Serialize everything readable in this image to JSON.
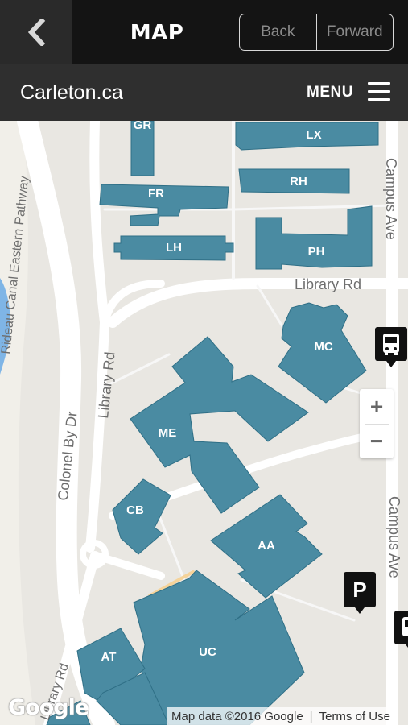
{
  "header": {
    "title": "MAP",
    "back_label": "Back",
    "forward_label": "Forward"
  },
  "subheader": {
    "site_name": "Carleton.ca",
    "menu_label": "MENU"
  },
  "map": {
    "buildings": [
      "GR",
      "LX",
      "FR",
      "RH",
      "LH",
      "PH",
      "MC",
      "ME",
      "CB",
      "AA",
      "AT",
      "UC"
    ],
    "roads": {
      "library_rd_top": "Library Rd",
      "library_rd_side": "Library Rd",
      "campus_ave_top": "Campus Ave",
      "campus_ave_bottom": "Campus Ave",
      "colonel_by": "Colonel By Dr",
      "canal_path": "Rideau Canal Eastern Pathway",
      "bottom_left_road": "Library Rd"
    },
    "zoom_in": "+",
    "zoom_out": "−",
    "poi_parking": "P",
    "google_logo": "Google",
    "attribution": "Map data ©2016 Google",
    "terms": "Terms of Use"
  },
  "colors": {
    "building_fill": "#4a8ba2",
    "building_stroke": "#2f6f86",
    "topbar_bg": "#141414",
    "subbar_bg": "#2f2f2f",
    "map_bg": "#e9e7e2",
    "water": "#7fb5e6"
  }
}
